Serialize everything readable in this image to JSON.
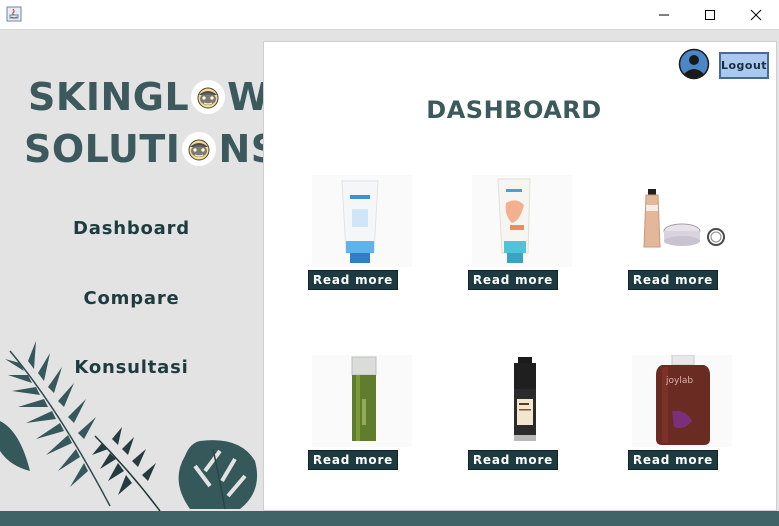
{
  "window": {
    "controls": {
      "minimize": "—",
      "maximize": "☐",
      "close": "✕"
    }
  },
  "sidebar": {
    "brand_line1_a": "SKINGL",
    "brand_line1_b": "W",
    "brand_line2_a": "SOLUTI",
    "brand_line2_b": "NS",
    "nav": [
      "Dashboard",
      "Compare",
      "Konsultasi"
    ]
  },
  "header": {
    "logout_label": "Logout"
  },
  "main": {
    "title": "DASHBOARD",
    "products": [
      {
        "name": "white-tube-blue-product",
        "button": "Read more"
      },
      {
        "name": "white-tube-orange-product",
        "button": "Read more"
      },
      {
        "name": "foundation-set-product",
        "button": "Read more"
      },
      {
        "name": "green-bottle-product",
        "button": "Read more"
      },
      {
        "name": "serum-pump-product",
        "button": "Read more"
      },
      {
        "name": "joylab-bottle-product",
        "button": "Read more"
      }
    ]
  },
  "colors": {
    "accent": "#3c5a5d",
    "button": "#1c3a3f",
    "logout": "#a9c9ef",
    "bottom_bar": "#3f6467"
  }
}
